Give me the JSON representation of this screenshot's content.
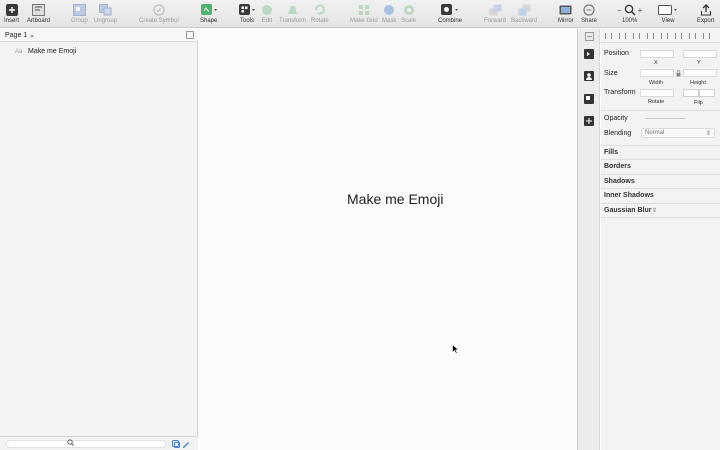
{
  "toolbar": {
    "insert": "Insert",
    "artboard": "Artboard",
    "group": "Group",
    "ungroup": "Ungroup",
    "create_symbol": "Create Symbol",
    "shape": "Shape",
    "tools": "Tools",
    "edit": "Edit",
    "transform": "Transform",
    "rotate": "Rotate",
    "make_grid": "Make Grid",
    "mask": "Mask",
    "scale": "Scale",
    "combine": "Combine",
    "forward": "Forward",
    "backward": "Backward",
    "mirror": "Mirror",
    "share": "Share",
    "zoom": "100%",
    "zoom_minus": "−",
    "zoom_plus": "+",
    "view": "View",
    "export": "Export"
  },
  "layers": {
    "page": "Page 1",
    "page_chevron": "⌄",
    "items": [
      {
        "icon": "Aa",
        "name": "Make me Emoji"
      }
    ]
  },
  "canvas": {
    "text": "Make me Emoji"
  },
  "inspector": {
    "position": "Position",
    "x": "X",
    "y": "Y",
    "size": "Size",
    "width": "Width",
    "height": "Height",
    "transform": "Transform",
    "rotate": "Rotate",
    "flip": "Flip",
    "opacity": "Opacity",
    "blending": "Blending",
    "blending_value": "Normal",
    "fills": "Fills",
    "borders": "Borders",
    "shadows": "Shadows",
    "inner_shadows": "Inner Shadows",
    "gaussian_blur": "Gaussian Blur"
  },
  "colors": {
    "accent": "#4a7fd8",
    "green": "#4bb36b"
  }
}
